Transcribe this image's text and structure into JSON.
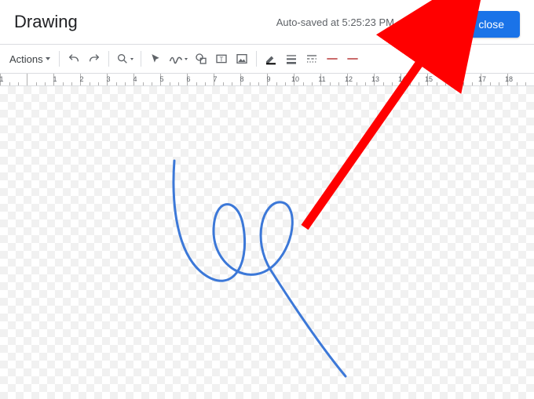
{
  "header": {
    "title": "Drawing",
    "autosave_text": "Auto-saved at 5:25:23 PM",
    "save_button": "Save and close"
  },
  "toolbar": {
    "actions_label": "Actions",
    "undo": "undo",
    "redo": "redo",
    "zoom": "zoom",
    "select": "select",
    "line": "line",
    "shape": "shape",
    "textbox": "textbox",
    "image": "image",
    "border_color": "border-color",
    "border_weight": "border-weight",
    "border_dash": "border-dash",
    "line_start": "line-start",
    "line_end": "line-end"
  },
  "ruler": {
    "labels": [
      "1",
      "",
      "1",
      "2",
      "3",
      "4",
      "5",
      "6",
      "7",
      "8",
      "9",
      "10",
      "11",
      "12",
      "13",
      "14",
      "15",
      "16",
      "17",
      "18"
    ]
  },
  "drawing": {
    "stroke_color": "#3c78d8",
    "description": "freehand-scribble"
  },
  "annotation": {
    "type": "arrow",
    "color": "#ff0000",
    "points_to": "save-button"
  }
}
